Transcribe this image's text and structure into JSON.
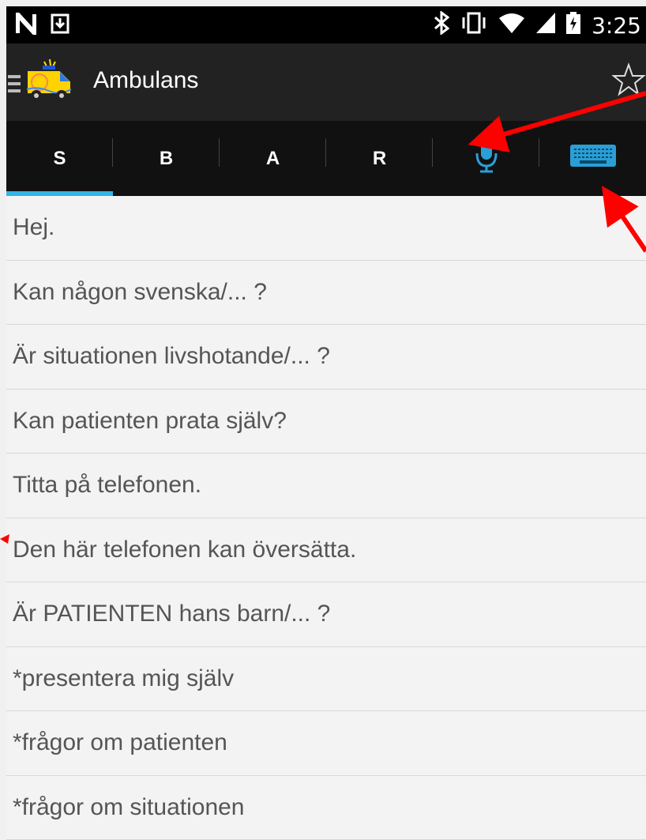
{
  "status_bar": {
    "time": "3:25",
    "icons": [
      "n-icon",
      "download-icon",
      "bluetooth-icon",
      "vibrate-icon",
      "wifi-icon",
      "cell-signal-icon",
      "battery-icon"
    ]
  },
  "app_bar": {
    "title": "Ambulans",
    "icons": [
      "drawer-icon",
      "ambulance-logo-icon",
      "star-icon"
    ]
  },
  "tabs": [
    {
      "label": "S",
      "active": true
    },
    {
      "label": "B",
      "active": false
    },
    {
      "label": "A",
      "active": false
    },
    {
      "label": "R",
      "active": false
    },
    {
      "icon": "microphone-icon"
    },
    {
      "icon": "keyboard-icon"
    }
  ],
  "phrases": [
    "Hej.",
    "Kan någon svenska/... ?",
    "Är situationen livshotande/... ?",
    "Kan patienten prata själv?",
    "Titta på telefonen.",
    "Den här telefonen kan översätta.",
    "Är PATIENTEN hans barn/... ?",
    "*presentera mig själv",
    "*frågor om patienten",
    "*frågor om situationen"
  ],
  "colors": {
    "accent": "#33b5e5",
    "annotation": "#ff0000",
    "background": "#f0f0f0"
  }
}
